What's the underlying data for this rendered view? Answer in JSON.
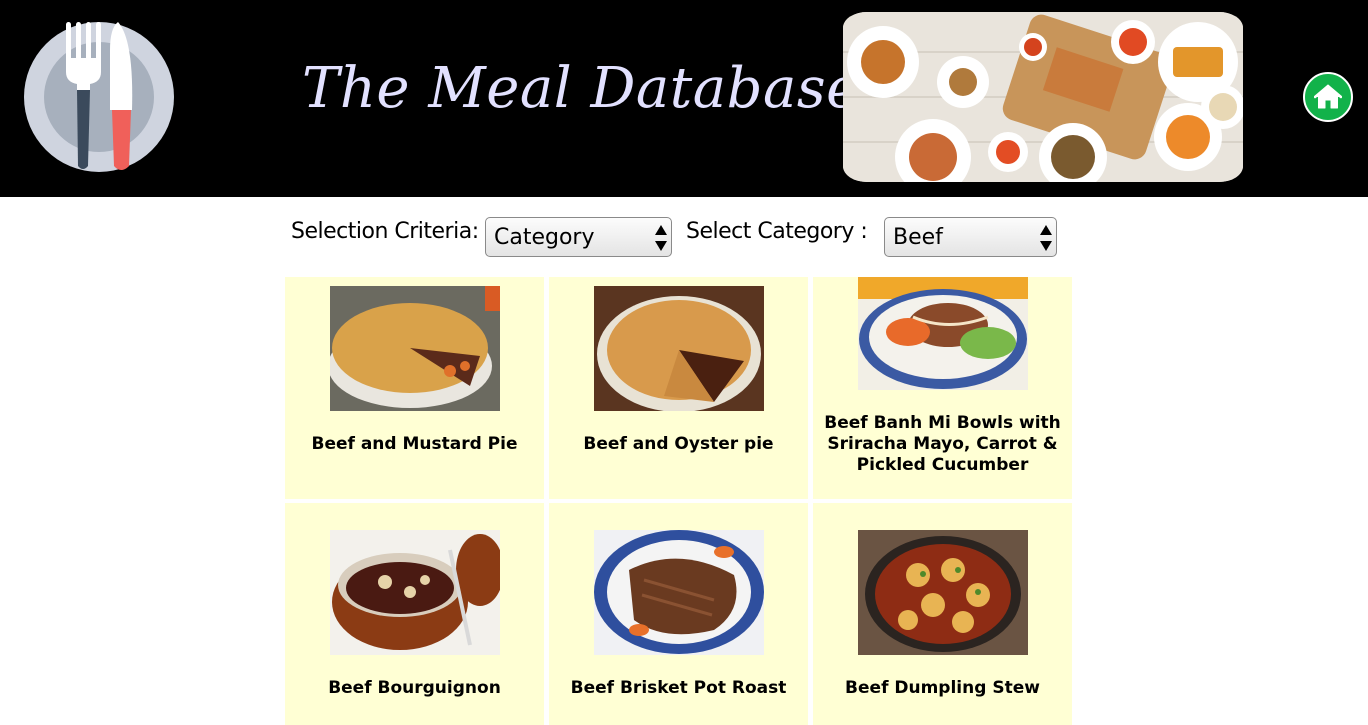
{
  "header": {
    "title": "The Meal Database",
    "logo_icon": "plate-fork-knife-icon",
    "home_icon": "home-icon",
    "home_color": "#12b24a"
  },
  "controls": {
    "criteria_label": "Selection Criteria:",
    "criteria_value": "Category",
    "category_label": "Select Category :",
    "category_value": "Beef"
  },
  "meals": [
    {
      "name": "Beef and Mustard Pie"
    },
    {
      "name": "Beef and Oyster pie"
    },
    {
      "name": "Beef Banh Mi Bowls with Sriracha Mayo, Carrot & Pickled Cucumber"
    },
    {
      "name": "Beef Bourguignon"
    },
    {
      "name": "Beef Brisket Pot Roast"
    },
    {
      "name": "Beef Dumpling Stew"
    }
  ],
  "colors": {
    "header_bg": "#000000",
    "card_bg": "#ffffd4",
    "title": "#e2e1ff"
  }
}
